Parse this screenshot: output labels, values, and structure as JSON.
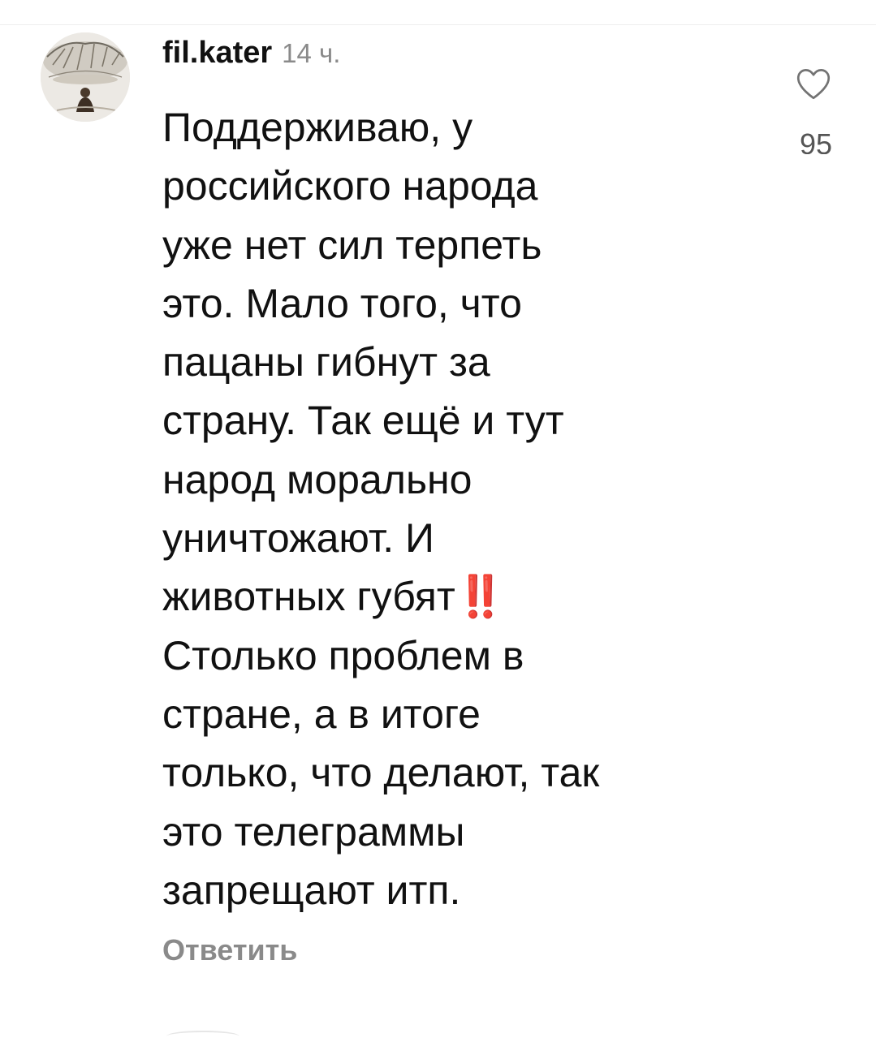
{
  "comment": {
    "username": "fil.kater",
    "time": "14 ч.",
    "text": "Поддерживаю,  у\nроссийского народа\nуже нет сил терпеть\nэто. Мало того, что\nпацаны гибнут за\nстрану. Так ещё и тут\nнарод морально\nуничтожают. И\nживотных губят‼️\nСтолько проблем в\nстране, а в итоге\nтолько, что делают, так\nэто телеграммы\nзапрещают итп.",
    "reply_label": "Ответить",
    "like_count": "95"
  },
  "colors": {
    "text": "#111111",
    "muted": "#8a8a8a",
    "divider": "#ededed"
  },
  "icons": {
    "avatar": "profile-photo",
    "like": "heart-outline-icon"
  }
}
